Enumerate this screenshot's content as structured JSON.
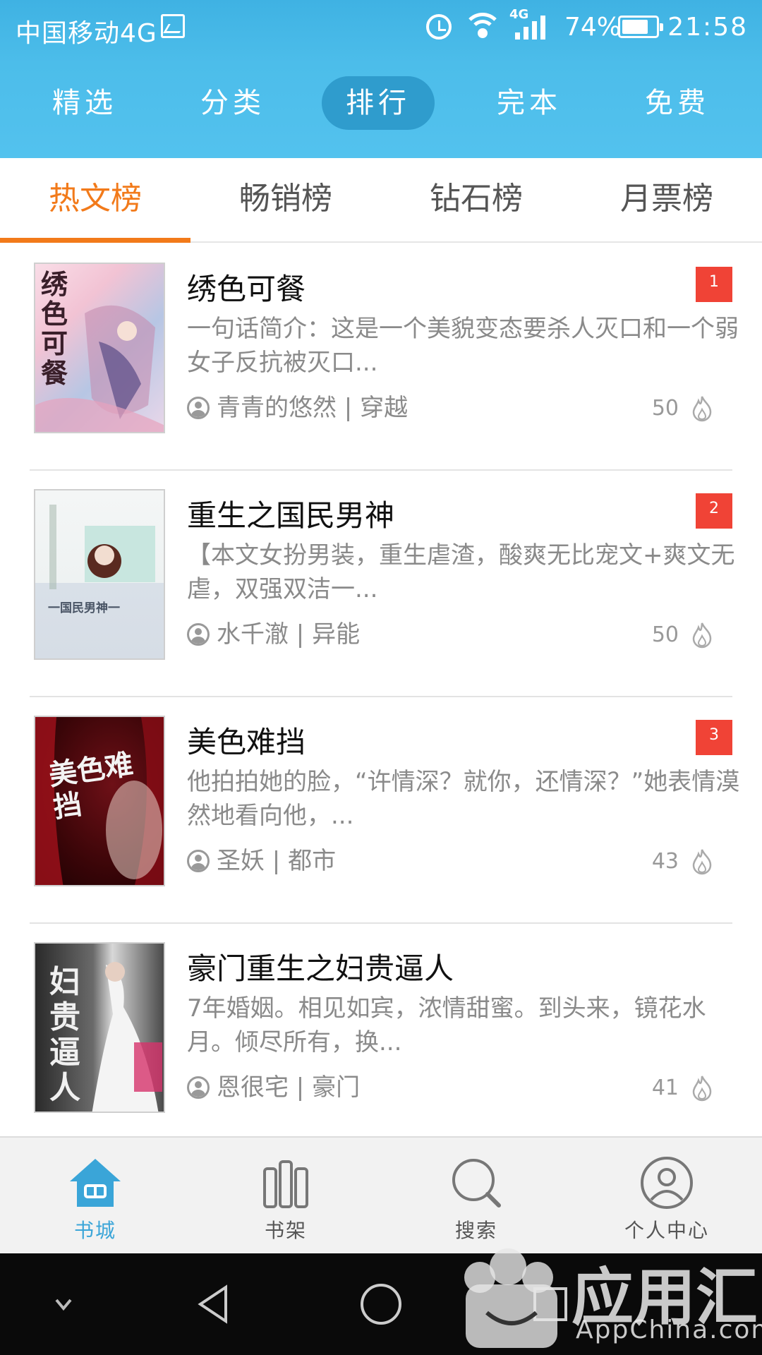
{
  "status_bar": {
    "carrier": "中国移动4G",
    "network": "4G",
    "battery": "74%",
    "time": "21:58"
  },
  "top_nav": {
    "tabs": [
      {
        "label": "精选",
        "active": false
      },
      {
        "label": "分类",
        "active": false
      },
      {
        "label": "排行",
        "active": true
      },
      {
        "label": "完本",
        "active": false
      },
      {
        "label": "免费",
        "active": false
      }
    ]
  },
  "sub_tabs": {
    "tabs": [
      {
        "label": "热文榜",
        "active": true
      },
      {
        "label": "畅销榜",
        "active": false
      },
      {
        "label": "钻石榜",
        "active": false
      },
      {
        "label": "月票榜",
        "active": false
      }
    ],
    "accent_color": "#f27a1a"
  },
  "books": [
    {
      "title": "绣色可餐",
      "rank": "1",
      "description": "一句话简介：这是一个美貌变态要杀人灭口和一个弱女子反抗被灭口...",
      "author": "青青的悠然",
      "genre": "穿越",
      "meta": "青青的悠然 | 穿越",
      "heat": "50",
      "cover_title": "绣色可餐"
    },
    {
      "title": "重生之国民男神",
      "rank": "2",
      "description": "【本文女扮男装，重生虐渣，酸爽无比宠文+爽文无虐，双强双洁一...",
      "author": "水千澈",
      "genre": "异能",
      "meta": "水千澈 | 异能",
      "heat": "50",
      "cover_title": "一国民男神一"
    },
    {
      "title": "美色难挡",
      "rank": "3",
      "description": "他拍拍她的脸，“许情深？就你，还情深？”她表情漠然地看向他，...",
      "author": "圣妖",
      "genre": "都市",
      "meta": "圣妖 | 都市",
      "heat": "43",
      "cover_title": "美色难挡"
    },
    {
      "title": "豪门重生之妇贵逼人",
      "rank": "",
      "description": "7年婚姻。相见如宾，浓情甜蜜。到头来，镜花水月。倾尽所有，换...",
      "author": "恩很宅",
      "genre": "豪门",
      "meta": "恩很宅 | 豪门",
      "heat": "41",
      "cover_title": "妇贵逼人"
    }
  ],
  "bottom_nav": {
    "items": [
      {
        "label": "书城",
        "icon": "home-icon",
        "active": true
      },
      {
        "label": "书架",
        "icon": "bookshelf-icon",
        "active": false
      },
      {
        "label": "搜索",
        "icon": "search-icon",
        "active": false
      },
      {
        "label": "个人中心",
        "icon": "profile-icon",
        "active": false
      }
    ],
    "active_color": "#3aa5d8"
  },
  "watermark": {
    "text": "应用汇",
    "sub": "AppChina.com"
  },
  "colors": {
    "header_blue": "#4cbdea",
    "active_tab_bg": "#2f9ccd",
    "rank_badge": "#f04336"
  }
}
